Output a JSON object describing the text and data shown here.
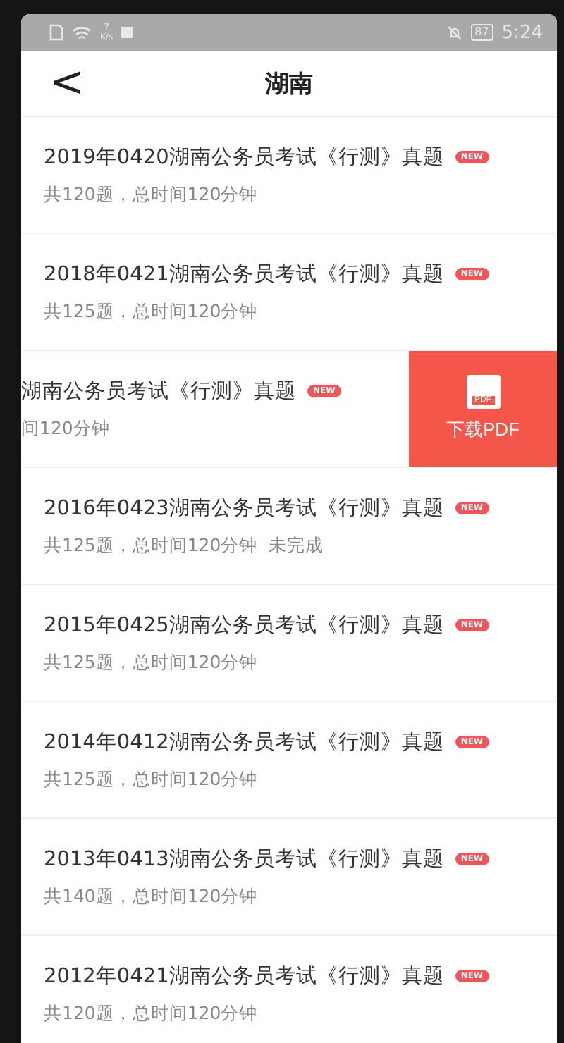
{
  "status_bar": {
    "speed_value": "7",
    "speed_unit": "K/s",
    "battery": "87",
    "time": "5:24"
  },
  "header": {
    "back": "<",
    "title": "湖南"
  },
  "rows": [
    {
      "kind": "normal",
      "title": "2019年0420湖南公务员考试《行测》真题",
      "badge": "NEW",
      "info": "共120题，总时间120分钟"
    },
    {
      "kind": "normal",
      "title": "2018年0421湖南公务员考试《行测》真题",
      "badge": "NEW",
      "info": "共125题，总时间120分钟"
    },
    {
      "kind": "swiped",
      "title": "湖南公务员考试《行测》真题",
      "badge": "NEW",
      "info": "间120分钟",
      "action": {
        "icon_label": "PDF",
        "label": "下载PDF"
      }
    },
    {
      "kind": "normal",
      "title": "2016年0423湖南公务员考试《行测》真题",
      "badge": "NEW",
      "info": "共125题，总时间120分钟",
      "status": "未完成"
    },
    {
      "kind": "normal",
      "title": "2015年0425湖南公务员考试《行测》真题",
      "badge": "NEW",
      "info": "共125题，总时间120分钟"
    },
    {
      "kind": "normal",
      "title": "2014年0412湖南公务员考试《行测》真题",
      "badge": "NEW",
      "info": "共125题，总时间120分钟"
    },
    {
      "kind": "normal",
      "title": "2013年0413湖南公务员考试《行测》真题",
      "badge": "NEW",
      "info": "共140题，总时间120分钟"
    },
    {
      "kind": "normal",
      "title": "2012年0421湖南公务员考试《行测》真题",
      "badge": "NEW",
      "info": "共120题，总时间120分钟"
    }
  ]
}
